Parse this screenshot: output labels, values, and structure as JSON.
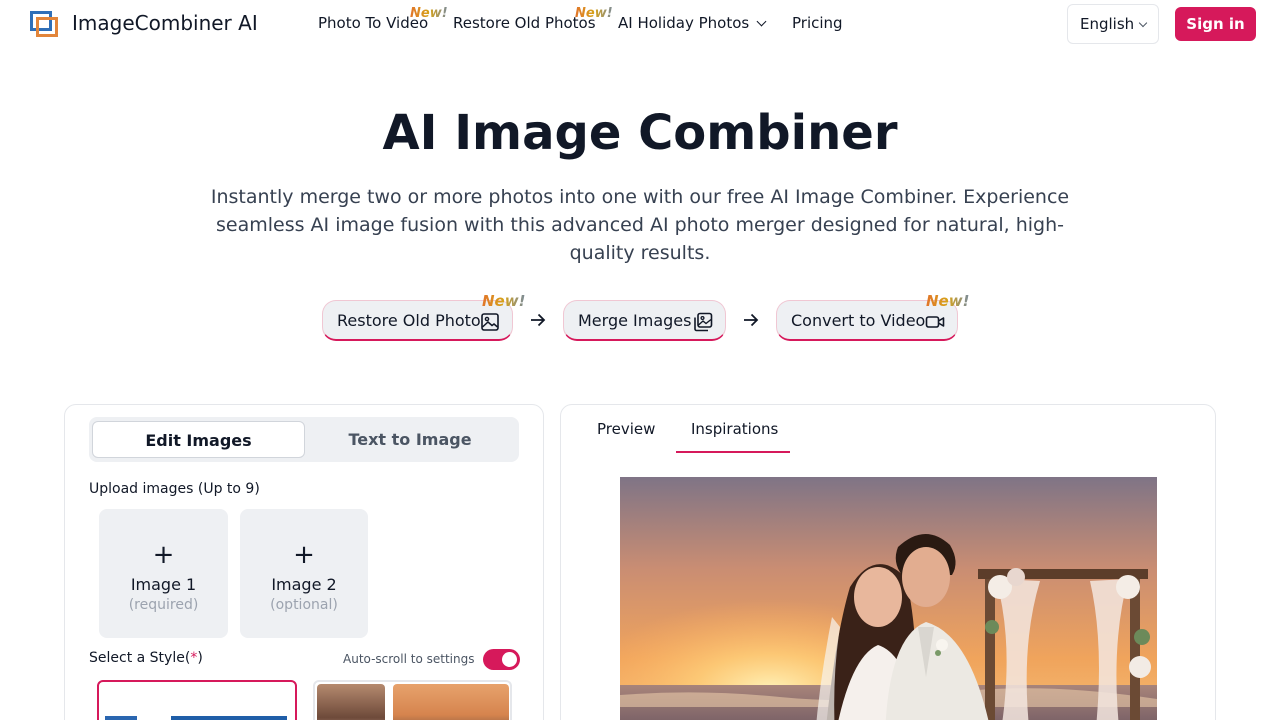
{
  "brand": {
    "name": "ImageCombiner AI",
    "accent_color": "#d6195b"
  },
  "nav": {
    "items": [
      {
        "label": "Photo To Video",
        "badge": "New!"
      },
      {
        "label": "Restore Old Photos",
        "badge": "New!"
      },
      {
        "label": "AI Holiday Photos",
        "dropdown_icon": "chevron-down-icon"
      },
      {
        "label": "Pricing"
      }
    ],
    "language": "English",
    "sign_in": "Sign in"
  },
  "hero": {
    "title": "AI Image Combiner",
    "subtitle": "Instantly merge two or more photos into one with our free AI Image Combiner. Experience seamless AI image fusion with this advanced AI photo merger designed for natural, high-quality results."
  },
  "steps": [
    {
      "label": "Restore Old Photo",
      "badge": "New!",
      "icon": "image-icon"
    },
    {
      "label": "Merge Images",
      "icon": "images-icon"
    },
    {
      "label": "Convert to Video",
      "badge": "New!",
      "icon": "video-icon"
    }
  ],
  "editor": {
    "tabs": [
      {
        "label": "Edit Images",
        "active": true
      },
      {
        "label": "Text to Image",
        "active": false
      }
    ],
    "upload_label": "Upload images (Up to 9)",
    "upload_slots": [
      {
        "plus": "+",
        "name": "Image 1",
        "hint": "(required)"
      },
      {
        "plus": "+",
        "name": "Image 2",
        "hint": "(optional)"
      }
    ],
    "style_label": "Select a Style",
    "style_required_mark": "*",
    "autoscroll_label": "Auto-scroll to settings",
    "autoscroll_on": true
  },
  "preview": {
    "tabs": [
      {
        "label": "Preview",
        "active": false
      },
      {
        "label": "Inspirations",
        "active": true
      }
    ]
  }
}
